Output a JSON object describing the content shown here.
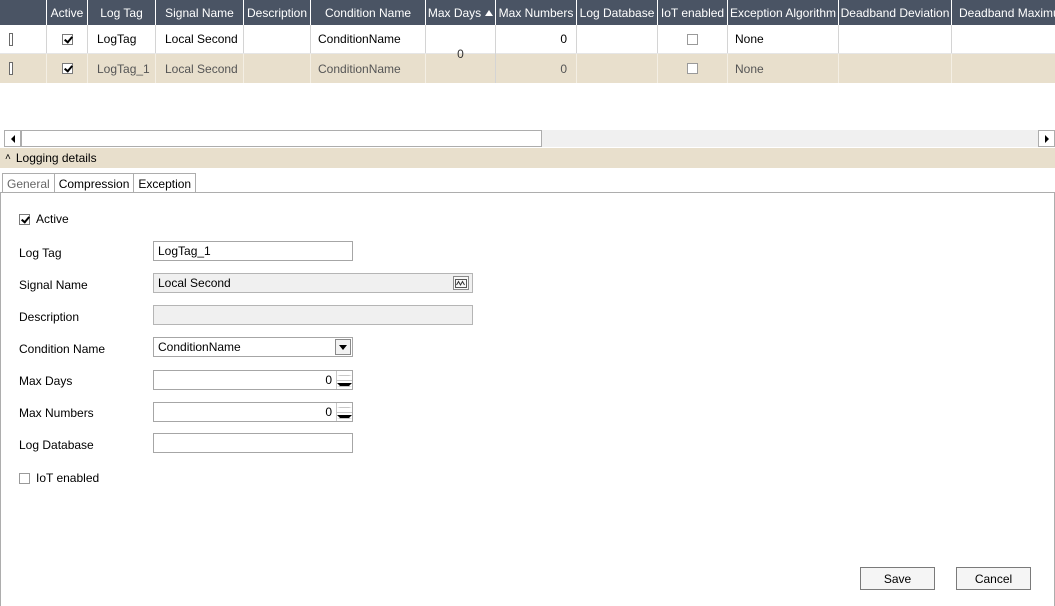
{
  "grid": {
    "columns": [
      "Active",
      "Log Tag",
      "Signal Name",
      "Description",
      "Condition Name",
      "Max Days",
      "Max Numbers",
      "Log Database",
      "IoT enabled",
      "Exception Algorithm",
      "Deadband Deviation",
      "Deadband Maximum"
    ],
    "rows": [
      {
        "active": true,
        "log_tag": "LogTag",
        "signal_name": "Local Second",
        "description": "",
        "condition_name": "ConditionName",
        "max_numbers": "0",
        "log_database": "",
        "iot_enabled": false,
        "exception_algorithm": "None",
        "deadband_deviation": "",
        "deadband_maximum": ""
      },
      {
        "active": true,
        "log_tag": "LogTag_1",
        "signal_name": "Local Second",
        "description": "",
        "condition_name": "ConditionName",
        "max_numbers": "0",
        "log_database": "",
        "iot_enabled": false,
        "exception_algorithm": "None",
        "deadband_deviation": "",
        "deadband_maximum": ""
      }
    ],
    "max_days_value": "0"
  },
  "details": {
    "title": "Logging details",
    "tabs": [
      "General",
      "Compression",
      "Exception"
    ],
    "active_tab": "General"
  },
  "form": {
    "active_label": "Active",
    "active_checked": true,
    "log_tag_label": "Log Tag",
    "log_tag_value": "LogTag_1",
    "signal_name_label": "Signal Name",
    "signal_name_value": "Local Second",
    "description_label": "Description",
    "description_value": "",
    "condition_name_label": "Condition Name",
    "condition_name_value": "ConditionName",
    "max_days_label": "Max Days",
    "max_days_value": "0",
    "max_numbers_label": "Max Numbers",
    "max_numbers_value": "0",
    "log_database_label": "Log Database",
    "log_database_value": "",
    "iot_label": "IoT enabled",
    "iot_checked": false
  },
  "buttons": {
    "save": "Save",
    "cancel": "Cancel"
  },
  "icons": [
    "document-icon",
    "checkbox-icon",
    "sort-ascending-icon",
    "scroll-left-icon",
    "scroll-right-icon",
    "collapse-chevron-icon",
    "spin-up-icon",
    "spin-down-icon",
    "dropdown-arrow-icon",
    "signal-browse-icon"
  ],
  "colors": {
    "header_bg": "#4a5464",
    "selected_row_bg": "#e8dfcc"
  }
}
